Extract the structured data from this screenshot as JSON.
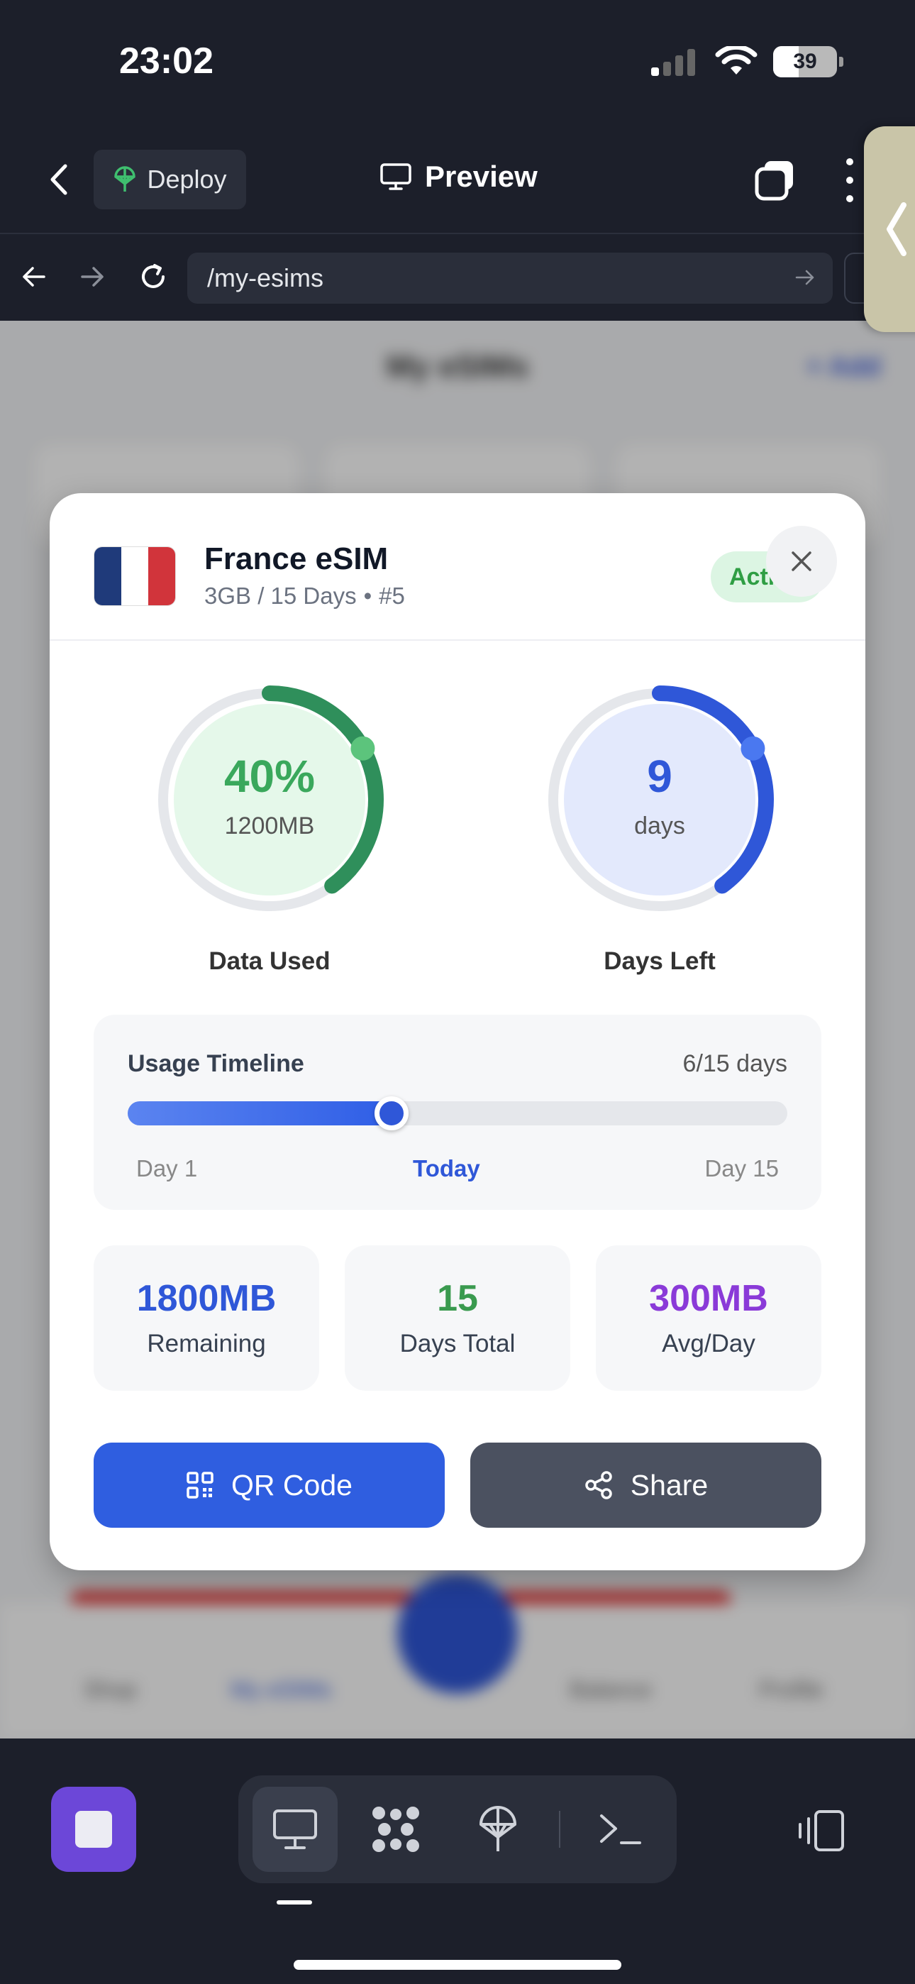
{
  "status_bar": {
    "time": "23:02",
    "battery": "39",
    "battery_level": 0.39
  },
  "header": {
    "deploy_label": "Deploy",
    "preview_label": "Preview"
  },
  "url_bar": {
    "url": "/my-esims"
  },
  "background_app": {
    "title": "My eSIMs",
    "nav_items": [
      "Shop",
      "My eSIMs",
      "Balance",
      "Profile"
    ]
  },
  "modal": {
    "title": "France eSIM",
    "plan": "3GB / 15 Days",
    "separator": "•",
    "number": "#5",
    "status": "Active",
    "flag_colors": [
      "#1f3a7a",
      "#ffffff",
      "#d1343b"
    ],
    "data_gauge": {
      "value": "40%",
      "unit": "1200MB",
      "label": "Data Used",
      "fraction": 0.4,
      "color": "#2f8f5b",
      "value_color": "#3aa85c"
    },
    "days_gauge": {
      "value": "9",
      "unit": "days",
      "label": "Days Left",
      "fraction": 0.4,
      "color": "#2f57d8",
      "value_color": "#2f57d8"
    },
    "timeline": {
      "title": "Usage Timeline",
      "count": "6/15 days",
      "progress": 0.4,
      "start_label": "Day 1",
      "today_label": "Today",
      "end_label": "Day 15"
    },
    "stats": [
      {
        "value": "1800MB",
        "label": "Remaining",
        "color": "#2f57d8"
      },
      {
        "value": "15",
        "label": "Days Total",
        "color": "#3a9a4f"
      },
      {
        "value": "300MB",
        "label": "Avg/Day",
        "color": "#8a3ad8"
      }
    ],
    "buttons": {
      "qr_label": "QR Code",
      "share_label": "Share"
    }
  },
  "toolbar": {
    "tools": [
      "monitor-icon",
      "grid-icon",
      "deploy-icon",
      "terminal-icon"
    ]
  },
  "colors": {
    "accent_blue": "#2f57d8",
    "share_button": "#4b5160",
    "stop_button": "#6c47d8"
  }
}
